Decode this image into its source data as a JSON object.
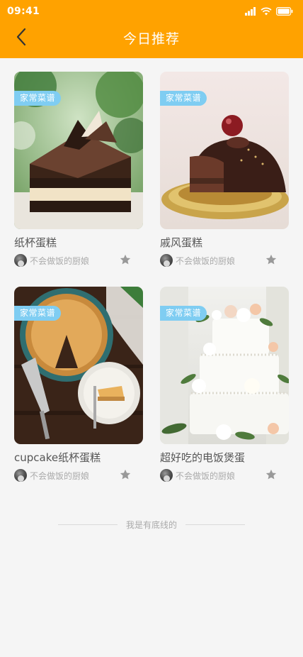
{
  "status_bar": {
    "time": "09:41",
    "icons": [
      "signal-icon",
      "wifi-icon",
      "battery-icon"
    ]
  },
  "header": {
    "title": "今日推荐",
    "back_icon": "chevron-left-icon",
    "background": "#FFA200"
  },
  "recipes": [
    {
      "tag": "家常菜谱",
      "title": "纸杯蛋糕",
      "author": "不会做饭的厨娘",
      "image": "chocolate-layer-cake-slice",
      "favorite_icon": "star-icon"
    },
    {
      "tag": "家常菜谱",
      "title": "戚风蛋糕",
      "author": "不会做饭的厨娘",
      "image": "chocolate-dome-cake",
      "favorite_icon": "star-icon"
    },
    {
      "tag": "家常菜谱",
      "title": "cupcake纸杯蛋糕",
      "author": "不会做饭的厨娘",
      "image": "cheesecake-pie",
      "favorite_icon": "star-icon"
    },
    {
      "tag": "家常菜谱",
      "title": "超好吃的电饭煲蛋",
      "author": "不会做饭的厨娘",
      "image": "white-floral-wedding-cake",
      "favorite_icon": "star-icon"
    }
  ],
  "footer": {
    "text": "我是有底线的"
  },
  "colors": {
    "accent": "#FFA200",
    "tag": "#7FCDF2",
    "background": "#F5F5F5",
    "star": "#999999"
  }
}
